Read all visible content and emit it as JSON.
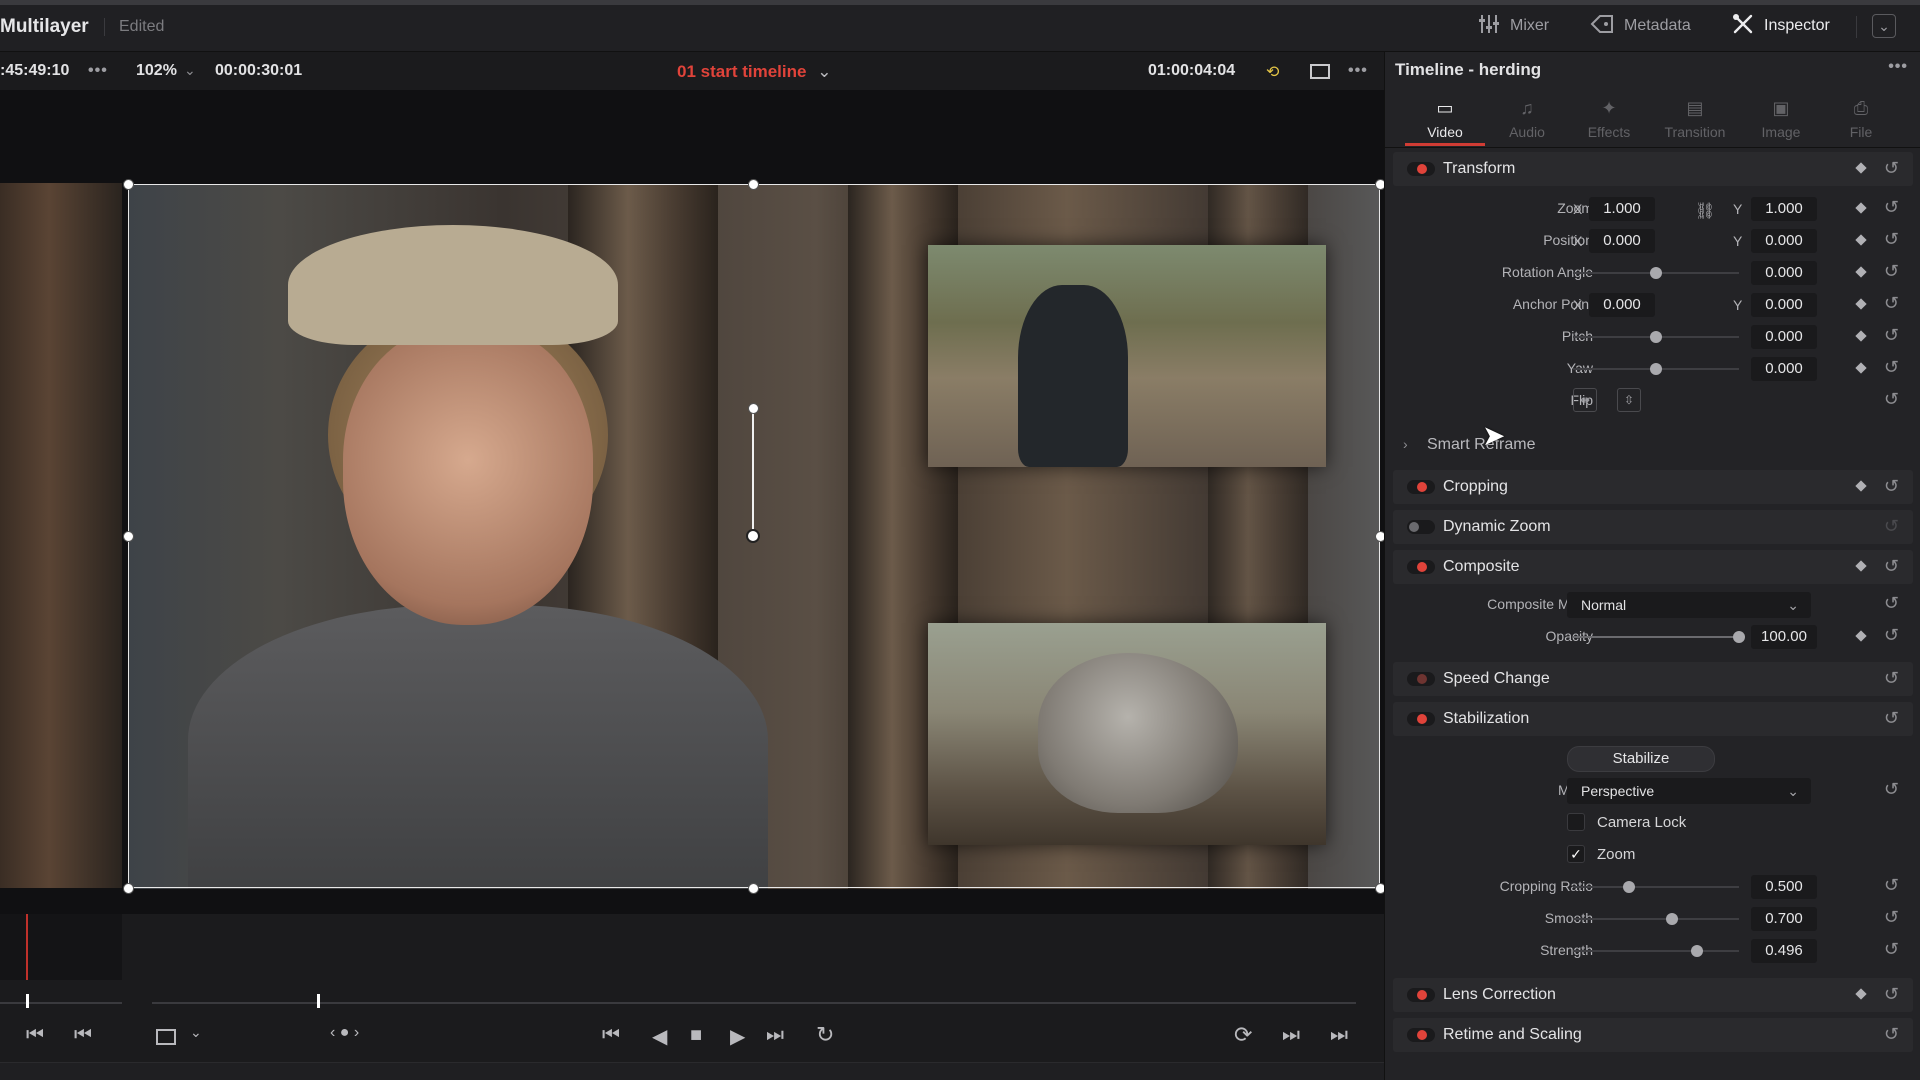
{
  "header": {
    "project_name": "Multilayer",
    "edited_label": "Edited",
    "mixer_label": "Mixer",
    "metadata_label": "Metadata",
    "inspector_label": "Inspector"
  },
  "viewer_toolbar": {
    "source_timecode": ":45:49:10",
    "zoom_level": "102%",
    "duration": "00:00:30:01",
    "timeline_name": "01 start timeline",
    "record_timecode": "01:00:04:04"
  },
  "inspector": {
    "title": "Timeline - herding",
    "tabs": [
      {
        "label": "Video",
        "icon": "film-icon",
        "active": true
      },
      {
        "label": "Audio",
        "icon": "music-note-icon",
        "active": false
      },
      {
        "label": "Effects",
        "icon": "magic-wand-icon",
        "active": false
      },
      {
        "label": "Transition",
        "icon": "transition-icon",
        "active": false
      },
      {
        "label": "Image",
        "icon": "image-icon",
        "active": false
      },
      {
        "label": "File",
        "icon": "file-icon",
        "active": false
      }
    ],
    "sections": {
      "transform": "Transform",
      "smart_reframe": "Smart Reframe",
      "cropping": "Cropping",
      "dynamic_zoom": "Dynamic Zoom",
      "composite": "Composite",
      "speed_change": "Speed Change",
      "stabilization": "Stabilization",
      "lens_correction": "Lens Correction",
      "retime_scaling": "Retime and Scaling"
    },
    "transform": {
      "zoom_label": "Zoom",
      "zoom_x": "1.000",
      "zoom_y": "1.000",
      "position_label": "Position",
      "position_x": "0.000",
      "position_y": "0.000",
      "rotation_label": "Rotation Angle",
      "rotation": "0.000",
      "anchor_label": "Anchor Point",
      "anchor_x": "0.000",
      "anchor_y": "0.000",
      "pitch_label": "Pitch",
      "pitch": "0.000",
      "yaw_label": "Yaw",
      "yaw": "0.000",
      "flip_label": "Flip",
      "x_axis": "X",
      "y_axis": "Y"
    },
    "composite": {
      "mode_label": "Composite Mode",
      "mode_value": "Normal",
      "opacity_label": "Opacity",
      "opacity": "100.00"
    },
    "stabilization": {
      "stabilize_button": "Stabilize",
      "mode_label": "Mode",
      "mode_value": "Perspective",
      "camera_lock_label": "Camera Lock",
      "camera_lock": false,
      "zoom_label": "Zoom",
      "zoom_checked": true,
      "cropping_ratio_label": "Cropping Ratio",
      "cropping_ratio": "0.500",
      "smooth_label": "Smooth",
      "smooth": "0.700",
      "strength_label": "Strength",
      "strength": "0.496"
    }
  },
  "colors": {
    "accent_red": "#e0433a",
    "panel_bg": "#232326",
    "viewer_bg": "#101012"
  }
}
